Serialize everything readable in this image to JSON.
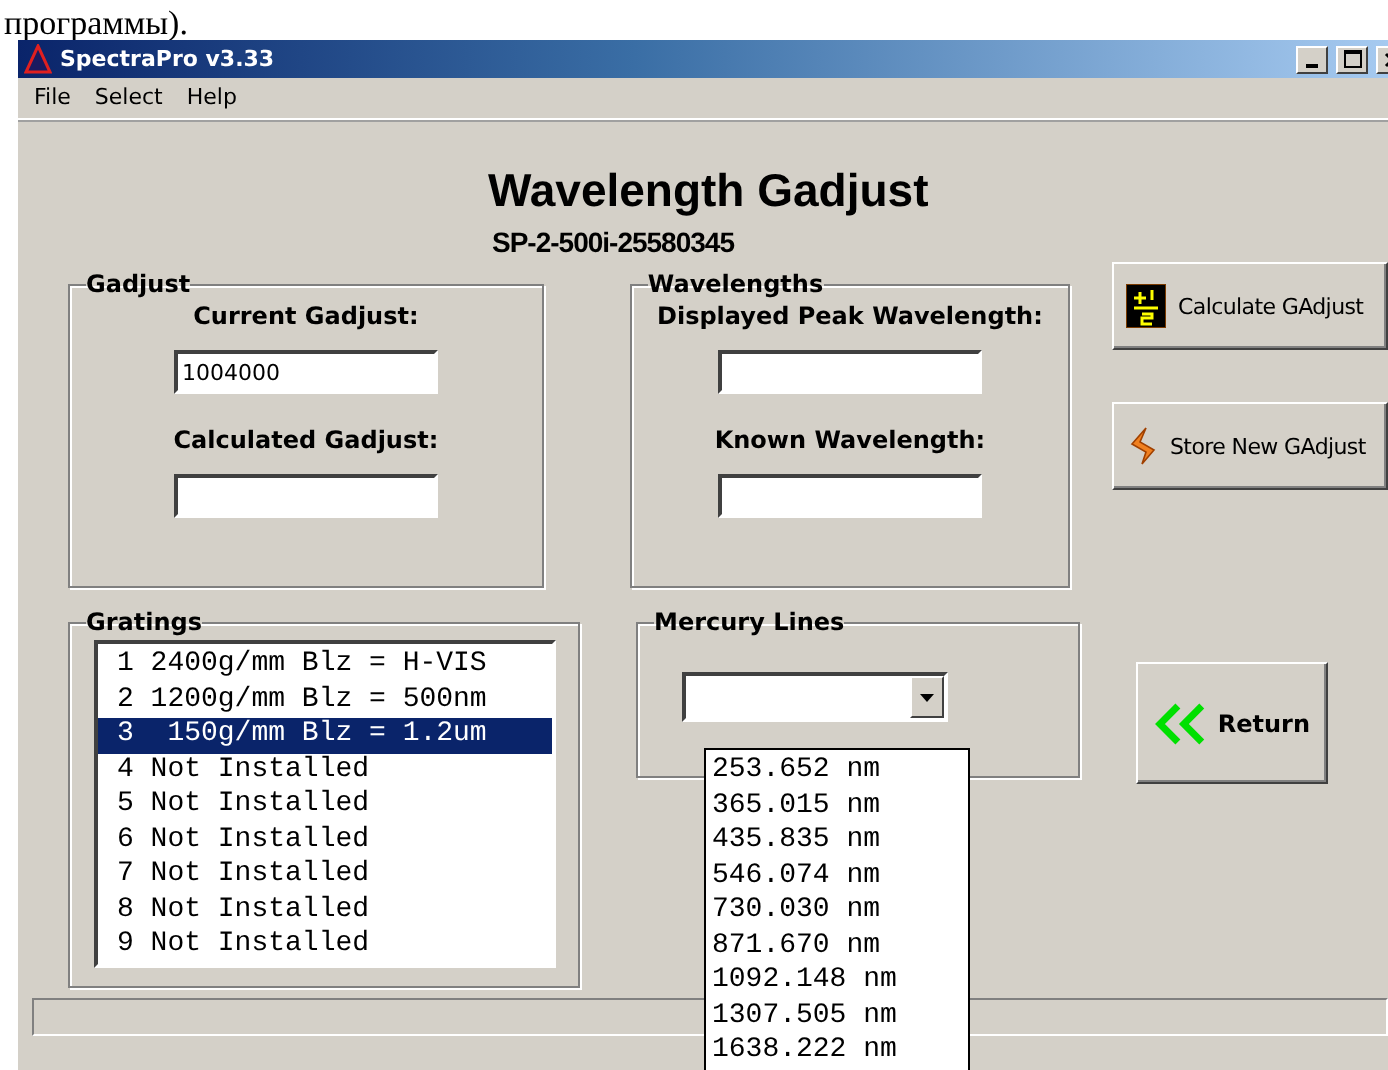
{
  "caption": "программы).",
  "window": {
    "title": "SpectraPro v3.33"
  },
  "menu": [
    "File",
    "Select",
    "Help"
  ],
  "heading": "Wavelength Gadjust",
  "subheading": "SP-2-500i-25580345",
  "gadjust": {
    "title": "Gadjust",
    "fields": [
      {
        "label": "Current Gadjust:",
        "value": "1004000"
      },
      {
        "label": "Calculated Gadjust:"
      }
    ]
  },
  "wavelengths": {
    "title": "Wavelengths",
    "fields": [
      {
        "label": "Displayed Peak Wavelength:"
      },
      {
        "label": "Known Wavelength:"
      }
    ]
  },
  "buttons": [
    {
      "label": "Calculate GAdjust"
    },
    {
      "label": "Store New GAdjust"
    }
  ],
  "gratings": {
    "title": "Gratings",
    "items": [
      {
        "label": "1 2400g/mm Blz = H-VIS",
        "selected": false
      },
      {
        "label": "2 1200g/mm Blz = 500nm",
        "selected": false
      },
      {
        "label": "3  150g/mm Blz = 1.2um",
        "selected": true
      },
      {
        "label": "4 Not Installed",
        "selected": false
      },
      {
        "label": "5 Not Installed",
        "selected": false
      },
      {
        "label": "6 Not Installed",
        "selected": false
      },
      {
        "label": "7 Not Installed",
        "selected": false
      },
      {
        "label": "8 Not Installed",
        "selected": false
      },
      {
        "label": "9 Not Installed",
        "selected": false
      }
    ]
  },
  "mercury_lines": {
    "title": "Mercury Lines",
    "expanded": true,
    "options": [
      "253.652 nm",
      "365.015 nm",
      "435.835 nm",
      "546.074 nm",
      "730.030 nm",
      "871.670 nm",
      "1092.148 nm",
      "1307.505 nm",
      "1638.222 nm"
    ]
  },
  "return_button": {
    "label": "Return"
  }
}
